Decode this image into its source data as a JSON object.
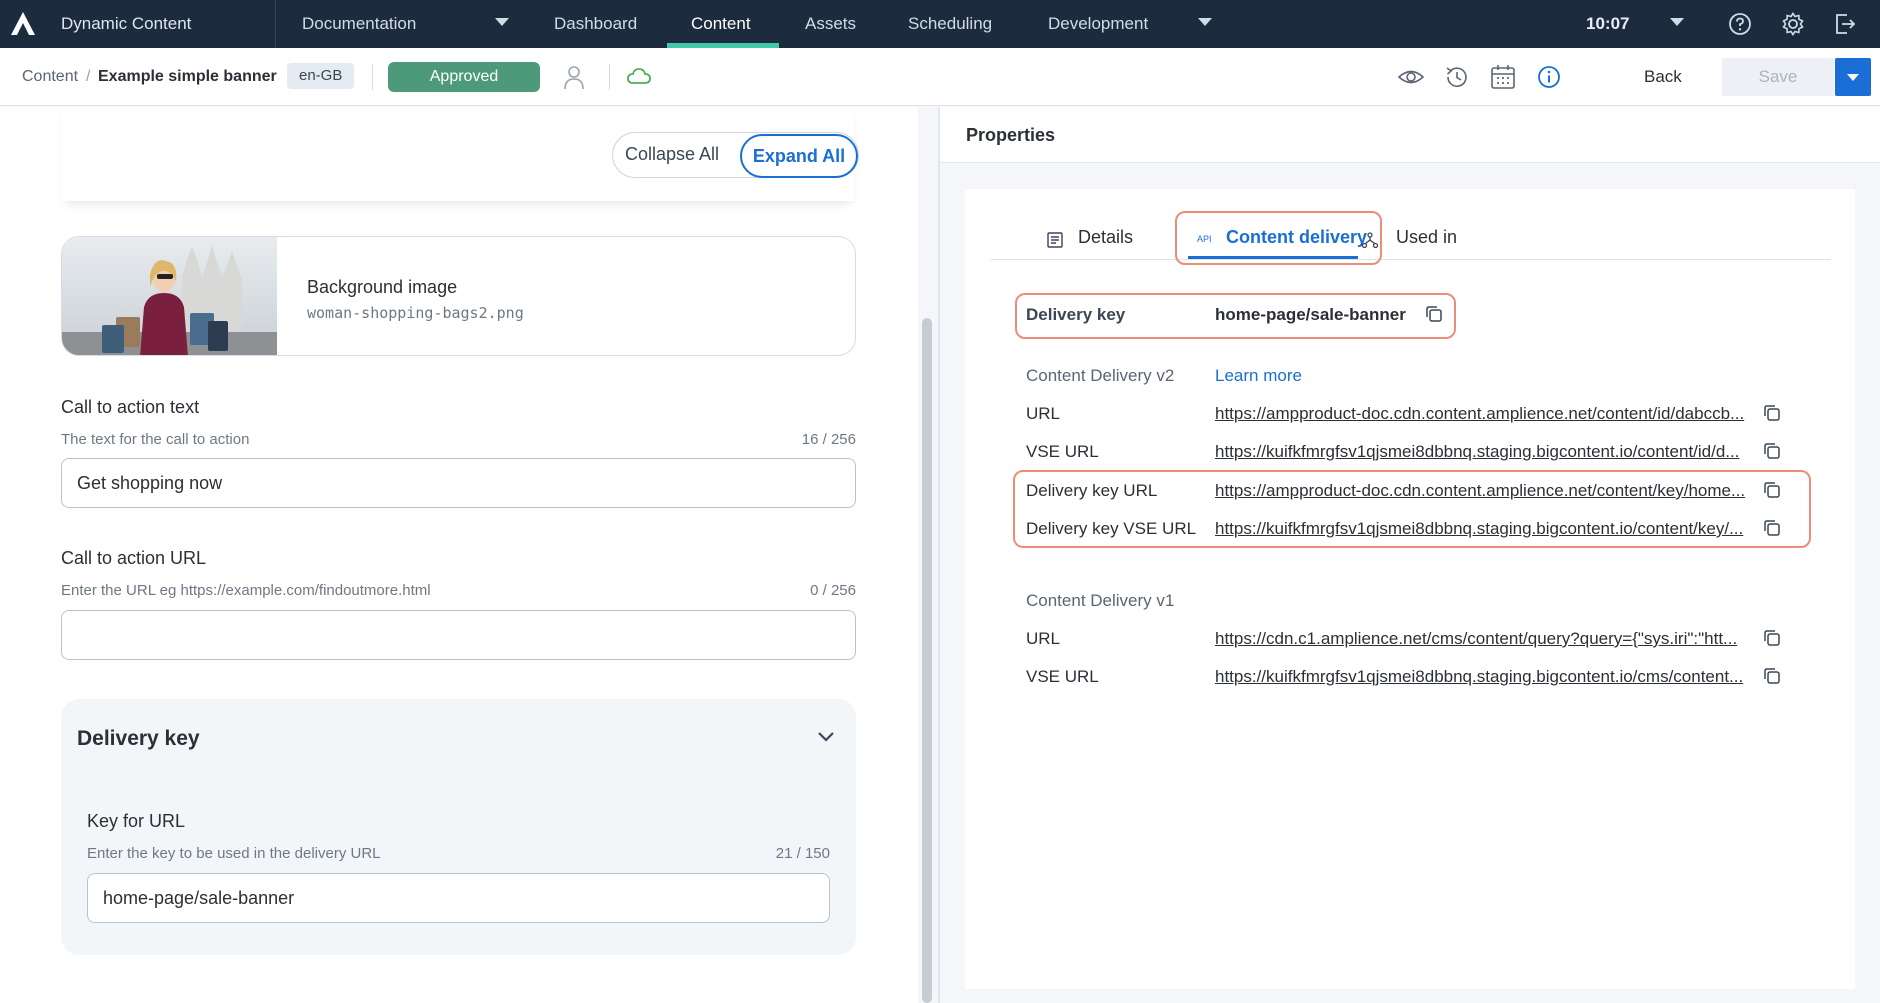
{
  "topnav": {
    "app_name": "Dynamic Content",
    "items": [
      {
        "label": "Documentation",
        "has_caret": true
      },
      {
        "label": "Dashboard"
      },
      {
        "label": "Content",
        "active": true
      },
      {
        "label": "Assets"
      },
      {
        "label": "Scheduling"
      },
      {
        "label": "Development",
        "has_caret": true
      }
    ],
    "time": "10:07",
    "icons": [
      "help-icon",
      "settings-icon",
      "logout-icon"
    ]
  },
  "subheader": {
    "breadcrumb_root": "Content",
    "breadcrumb_separator": "/",
    "breadcrumb_current": "Example simple banner",
    "locale": "en-GB",
    "status": "Approved",
    "back_label": "Back",
    "save_label": "Save"
  },
  "editor": {
    "collapse_all": "Collapse All",
    "expand_all": "Expand All",
    "background_image": {
      "title": "Background image",
      "filename": "woman-shopping-bags2.png"
    },
    "cta_text": {
      "label": "Call to action text",
      "help": "The text for the call to action",
      "count": "16 / 256",
      "value": "Get shopping now"
    },
    "cta_url": {
      "label": "Call to action URL",
      "help": "Enter the URL eg https://example.com/findoutmore.html",
      "count": "0 / 256",
      "value": ""
    },
    "delivery_key": {
      "section_title": "Delivery key",
      "label": "Key for URL",
      "help": "Enter the key to be used in the delivery URL",
      "count": "21 / 150",
      "value": "home-page/sale-banner"
    }
  },
  "properties": {
    "title": "Properties",
    "tabs": [
      {
        "label": "Details",
        "icon": "document-icon"
      },
      {
        "label": "Content delivery",
        "icon": "api-icon",
        "active": true
      },
      {
        "label": "Used in",
        "icon": "hierarchy-icon"
      }
    ],
    "api_badge": "API",
    "delivery_key_label": "Delivery key",
    "delivery_key_value": "home-page/sale-banner",
    "v2": {
      "heading": "Content Delivery v2",
      "learn_more": "Learn more",
      "rows": [
        {
          "label": "URL",
          "value": "https://ampproduct-doc.cdn.content.amplience.net/content/id/dabccb..."
        },
        {
          "label": "VSE URL",
          "value": "https://kuifkfmrgfsv1qjsmei8dbbnq.staging.bigcontent.io/content/id/d..."
        },
        {
          "label": "Delivery key URL",
          "value": "https://ampproduct-doc.cdn.content.amplience.net/content/key/home..."
        },
        {
          "label": "Delivery key VSE URL",
          "value": "https://kuifkfmrgfsv1qjsmei8dbbnq.staging.bigcontent.io/content/key/..."
        }
      ]
    },
    "v1": {
      "heading": "Content Delivery v1",
      "rows": [
        {
          "label": "URL",
          "value": "https://cdn.c1.amplience.net/cms/content/query?query={\"sys.iri\":\"htt..."
        },
        {
          "label": "VSE URL",
          "value": "https://kuifkfmrgfsv1qjsmei8dbbnq.staging.bigcontent.io/cms/content..."
        }
      ]
    }
  },
  "colors": {
    "nav_bg": "#1c2b3e",
    "accent": "#1b6ed6",
    "active_tab_bar": "#3fc9a4",
    "status_green": "#4d9a7a",
    "highlight": "#ef8b7a"
  }
}
